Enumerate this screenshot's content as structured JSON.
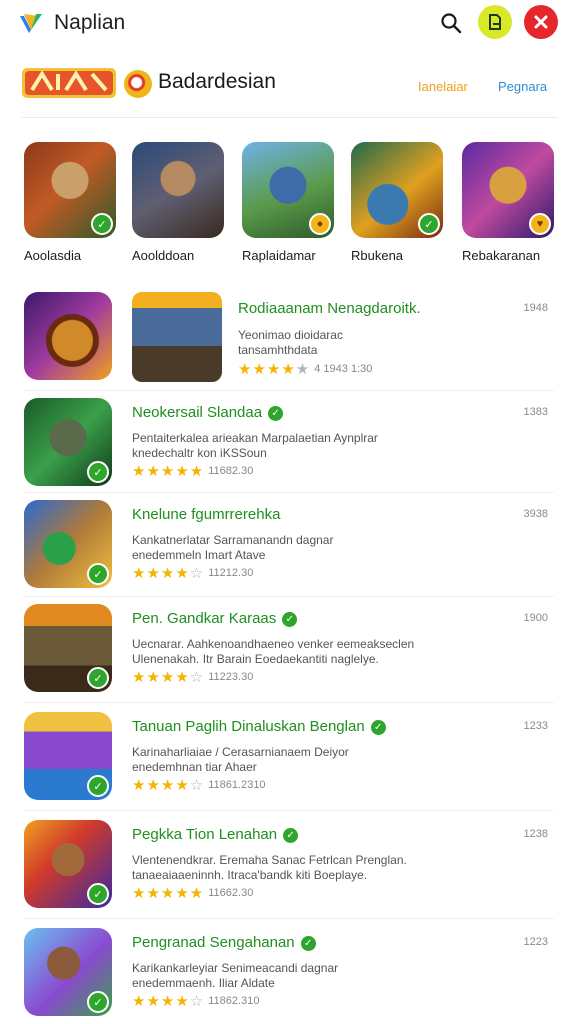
{
  "app": {
    "title": "Naplian"
  },
  "section": {
    "title": "Badardesian",
    "link_a": "Ianelaiar",
    "link_b": "Pegnara"
  },
  "featured": [
    {
      "label": "Aoolasdia",
      "badge": "check"
    },
    {
      "label": "Aoolddoan",
      "badge": "none"
    },
    {
      "label": "Raplaidamar",
      "badge": "gold"
    },
    {
      "label": "Rbukena",
      "badge": "check"
    },
    {
      "label": "Rebakaranan",
      "badge": "gold"
    }
  ],
  "list": [
    {
      "title": "Rodiaaanam Nenagdaroitk.",
      "desc": [
        "Yeonimao dioidarac",
        "tansamhthdata"
      ],
      "stars": 4,
      "meta": "4 1943 1:30",
      "count": "1948",
      "verified": false
    },
    {
      "title": "Neokersail Slandaa",
      "desc": [
        "Pentaiterkalea arieakan Marpalaetian Aynplrar",
        "knedechaltr kon iKSSoun"
      ],
      "stars": 5,
      "meta": "11682.30",
      "count": "1383",
      "verified": true
    },
    {
      "title": "Knelune fgumrrerehka",
      "desc": [
        "Kankatnerlatar Sarramanandn dagnar",
        "enedemmeln Imart Atave"
      ],
      "stars": 4,
      "meta": "11212.30",
      "count": "3938",
      "verified": false
    },
    {
      "title": "Pen. Gandkar Karaas",
      "desc": [
        "Uecnarar. Aahkenoandhaeneo venker eemeakseclen",
        "Ulenenakah. Itr Barain Eoedaekantiti naglelye."
      ],
      "stars": 4,
      "meta": "11223.30",
      "count": "1900",
      "verified": true
    },
    {
      "title": "Tanuan Paglih Dinaluskan Benglan",
      "desc": [
        "Karinaharliaiae / Cerasarnianaem Deiyor",
        "enedemhnan tiar Ahaer"
      ],
      "stars": 4,
      "meta": "11861.2310",
      "count": "1233",
      "verified": true
    },
    {
      "title": "Pegkka Tion Lenahan",
      "desc": [
        "Vlentenendkrar. Eremaha Sanac Fetrlcan Prenglan.",
        "tanaeaiaaeninnh. Itraca'bandk kiti Boeplaye."
      ],
      "stars": 5,
      "meta": "11662.30",
      "count": "1238",
      "verified": true
    },
    {
      "title": "Pengranad Sengahanan",
      "desc": [
        "Karikankarleyiar Senimeacandi dagnar",
        "enedemmaenh. Iliar Aldate"
      ],
      "stars": 4,
      "meta": "11862.310",
      "count": "1223",
      "verified": true
    }
  ],
  "colors": {
    "accent_green": "#1f8f1f",
    "star": "#f4b400",
    "close_red": "#e5262b",
    "doc_yellow": "#d9e92a",
    "link_orange": "#f0a11c",
    "link_blue": "#2a8fd6"
  },
  "icons": [
    "app-logo-icon",
    "search-icon",
    "document-icon",
    "close-icon",
    "check-badge-icon",
    "star-icon"
  ]
}
